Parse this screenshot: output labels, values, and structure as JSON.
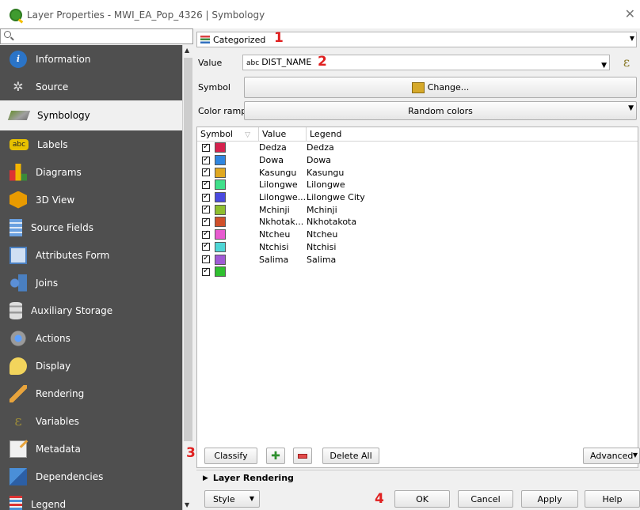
{
  "window": {
    "title": "Layer Properties - MWI_EA_Pop_4326 | Symbology",
    "close": "✕"
  },
  "sidebar": {
    "items": [
      {
        "label": "Information",
        "icon": "info-icon"
      },
      {
        "label": "Source",
        "icon": "source-icon"
      },
      {
        "label": "Symbology",
        "icon": "symbology-icon",
        "active": true
      },
      {
        "label": "Labels",
        "icon": "labels-icon"
      },
      {
        "label": "Diagrams",
        "icon": "diagrams-icon"
      },
      {
        "label": "3D View",
        "icon": "3d-view-icon"
      },
      {
        "label": "Source Fields",
        "icon": "source-fields-icon"
      },
      {
        "label": "Attributes Form",
        "icon": "attributes-form-icon"
      },
      {
        "label": "Joins",
        "icon": "joins-icon"
      },
      {
        "label": "Auxiliary Storage",
        "icon": "auxiliary-storage-icon"
      },
      {
        "label": "Actions",
        "icon": "actions-icon"
      },
      {
        "label": "Display",
        "icon": "display-icon"
      },
      {
        "label": "Rendering",
        "icon": "rendering-icon"
      },
      {
        "label": "Variables",
        "icon": "variables-icon"
      },
      {
        "label": "Metadata",
        "icon": "metadata-icon"
      },
      {
        "label": "Dependencies",
        "icon": "dependencies-icon"
      },
      {
        "label": "Legend",
        "icon": "legend-icon"
      }
    ],
    "info_glyph": "i",
    "labels_glyph": "abc",
    "vars_glyph": "ε"
  },
  "symbology": {
    "renderer": "Categorized",
    "value_label": "Value",
    "value_prefix": "abc",
    "value_field": "DIST_NAME",
    "symbol_label": "Symbol",
    "change_button": "Change...",
    "symbol_color": "#d6a92a",
    "color_ramp_label": "Color ramp",
    "color_ramp": "Random colors",
    "epsilon": "ε",
    "columns": {
      "symbol": "Symbol",
      "value": "Value",
      "legend": "Legend"
    },
    "rows": [
      {
        "value": "Dedza",
        "legend": "Dedza",
        "color": "#d6224e"
      },
      {
        "value": "Dowa",
        "legend": "Dowa",
        "color": "#2f86e0"
      },
      {
        "value": "Kasungu",
        "legend": "Kasungu",
        "color": "#e0a820"
      },
      {
        "value": "Lilongwe",
        "legend": "Lilongwe",
        "color": "#3fe08a"
      },
      {
        "value": "Lilongwe...",
        "legend": "Lilongwe City",
        "color": "#4a4ae0"
      },
      {
        "value": "Mchinji",
        "legend": "Mchinji",
        "color": "#8ebf2f"
      },
      {
        "value": "Nkhotak...",
        "legend": "Nkhotakota",
        "color": "#d0502a"
      },
      {
        "value": "Ntcheu",
        "legend": "Ntcheu",
        "color": "#e85ad0"
      },
      {
        "value": "Ntchisi",
        "legend": "Ntchisi",
        "color": "#4fd6d6"
      },
      {
        "value": "Salima",
        "legend": "Salima",
        "color": "#a05ad6"
      },
      {
        "value": "",
        "legend": "",
        "color": "#2fc02f"
      }
    ]
  },
  "actions": {
    "classify": "Classify",
    "delete_all": "Delete All",
    "advanced": "Advanced",
    "layer_rendering": "Layer Rendering",
    "style": "Style",
    "ok": "OK",
    "cancel": "Cancel",
    "apply": "Apply",
    "help": "Help"
  },
  "annotations": {
    "n1": "1",
    "n2": "2",
    "n3": "3",
    "n4": "4"
  }
}
